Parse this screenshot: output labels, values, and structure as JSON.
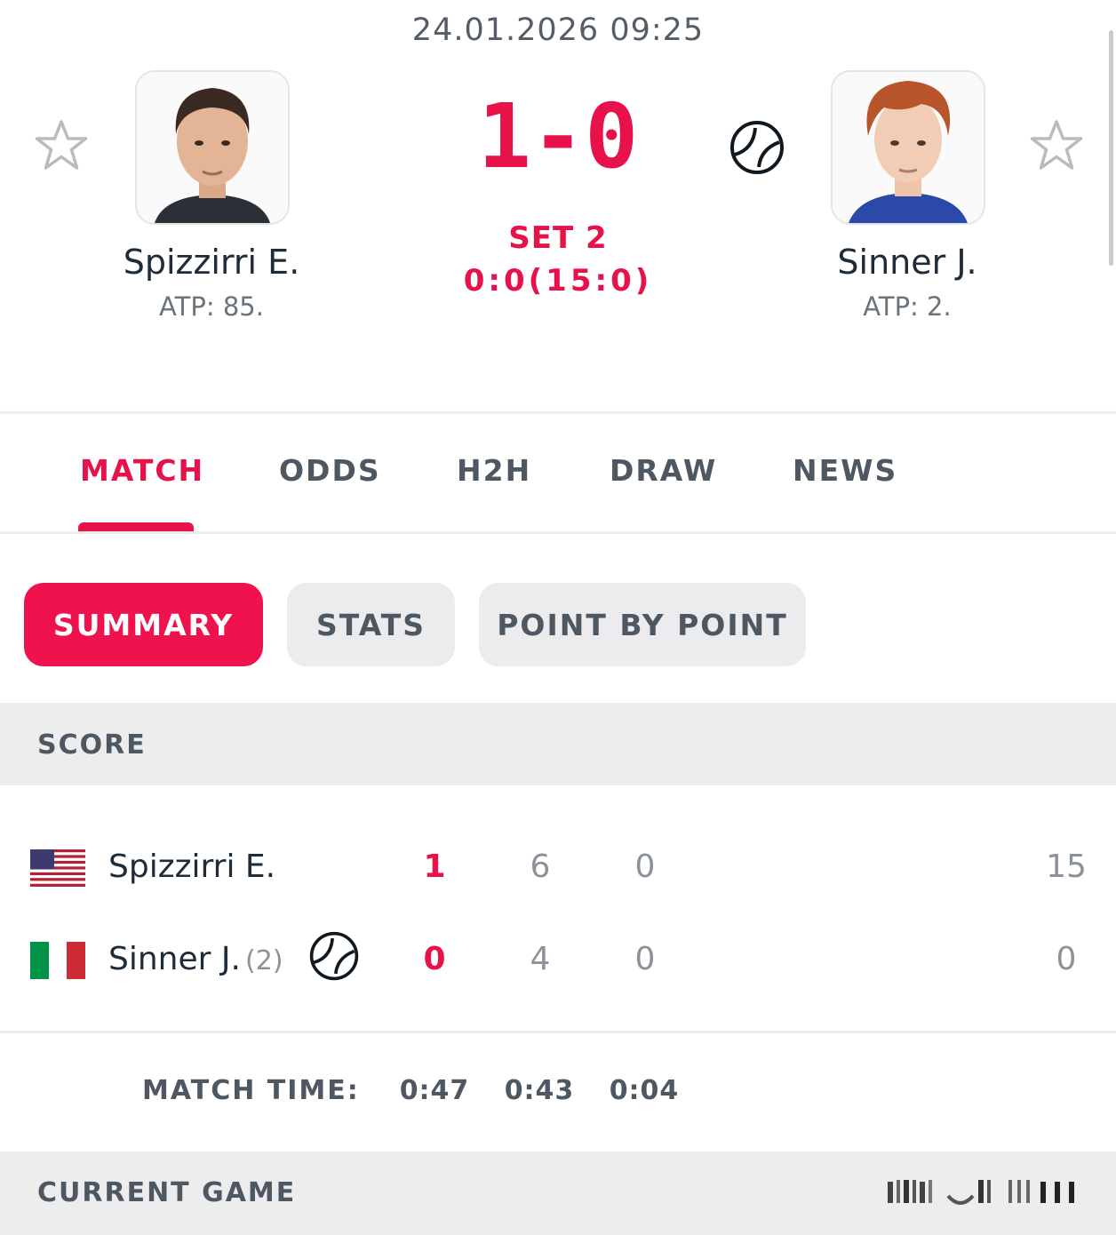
{
  "header": {
    "datetime": "24.01.2026 09:25",
    "score": "1-0",
    "set_label": "SET 2",
    "set_score": "0:0(15:0)"
  },
  "home": {
    "name": "Spizzirri E.",
    "rank": "ATP: 85."
  },
  "away": {
    "name": "Sinner J.",
    "rank": "ATP: 2.",
    "serving": true
  },
  "tabs": [
    {
      "label": "MATCH",
      "active": true
    },
    {
      "label": "ODDS"
    },
    {
      "label": "H2H"
    },
    {
      "label": "DRAW"
    },
    {
      "label": "NEWS"
    }
  ],
  "subtabs": [
    {
      "label": "SUMMARY",
      "active": true
    },
    {
      "label": "STATS"
    },
    {
      "label": "POINT BY POINT"
    }
  ],
  "score_section": {
    "title": "SCORE",
    "rows": [
      {
        "name": "Spizzirri E.",
        "seed": "",
        "sets": "1",
        "set1": "6",
        "set2": "0",
        "points": "15",
        "flag": "usa"
      },
      {
        "name": "Sinner J.",
        "seed": "(2)",
        "sets": "0",
        "set1": "4",
        "set2": "0",
        "points": "0",
        "flag": "italy"
      }
    ]
  },
  "match_time": {
    "label": "MATCH TIME:",
    "total": "0:47",
    "set1": "0:43",
    "set2": "0:04"
  },
  "current_game": {
    "title": "CURRENT GAME"
  },
  "colors": {
    "accent": "#e8124a",
    "muted": "#4e5863",
    "bar": "#ededee"
  }
}
